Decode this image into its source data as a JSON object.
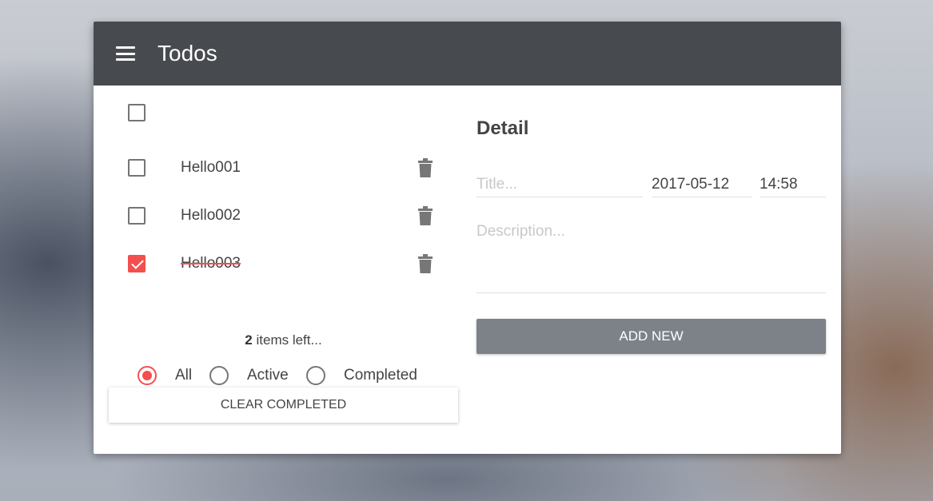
{
  "app": {
    "title": "Todos",
    "accent_color": "#f44e4e",
    "appbar_color": "#474a4f"
  },
  "todos": {
    "select_all_checked": false,
    "items": [
      {
        "label": "Hello001",
        "completed": false
      },
      {
        "label": "Hello002",
        "completed": false
      },
      {
        "label": "Hello003",
        "completed": true
      }
    ],
    "items_left_count": "2",
    "items_left_suffix": " items left..."
  },
  "filters": {
    "options": [
      "All",
      "Active",
      "Completed"
    ],
    "selected": "All"
  },
  "clear_completed_label": "CLEAR COMPLETED",
  "detail": {
    "heading": "Detail",
    "title_placeholder": "Title...",
    "title_value": "",
    "date_value": "2017-05-12",
    "time_value": "14:58",
    "description_placeholder": "Description...",
    "description_value": "",
    "add_button_label": "ADD NEW"
  }
}
